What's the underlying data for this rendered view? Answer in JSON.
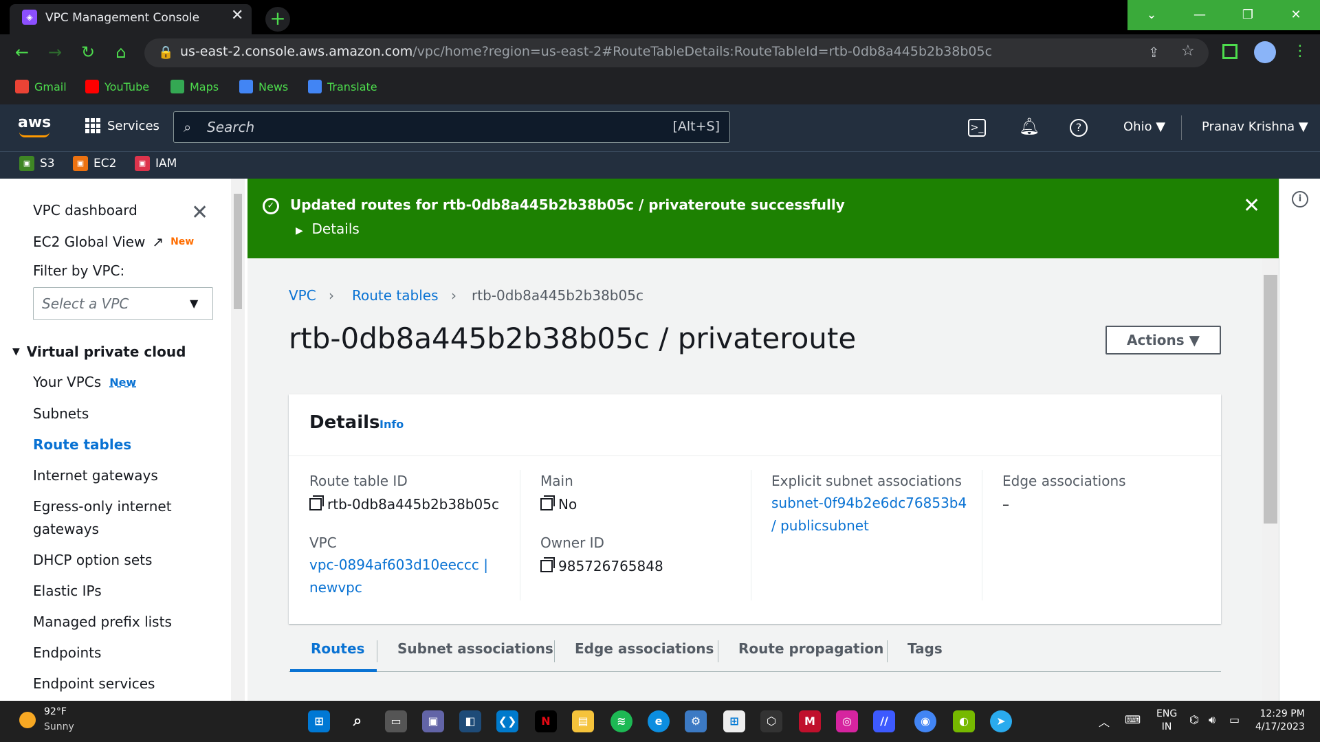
{
  "browser": {
    "tab_title": "VPC Management Console",
    "tab_close": "✕",
    "new_tab": "+",
    "url_host": "us-east-2.console.aws.amazon.com",
    "url_path": "/vpc/home?region=us-east-2#RouteTableDetails:RouteTableId=rtb-0db8a445b2b38b05c",
    "bookmarks": [
      {
        "label": "Gmail",
        "color": "#ea4335"
      },
      {
        "label": "YouTube",
        "color": "#ff0000"
      },
      {
        "label": "Maps",
        "color": "#34a853"
      },
      {
        "label": "News",
        "color": "#4285f4"
      },
      {
        "label": "Translate",
        "color": "#4285f4"
      }
    ]
  },
  "aws": {
    "logo": "aws",
    "services": "Services",
    "search_placeholder": "Search",
    "search_shortcut": "[Alt+S]",
    "region": "Ohio ▼",
    "user": "Pranav Krishna ▼",
    "favorites": [
      {
        "label": "S3",
        "color": "#3f8624",
        "icon": "S3"
      },
      {
        "label": "EC2",
        "color": "#ec7211",
        "icon": "EC2"
      },
      {
        "label": "IAM",
        "color": "#dd344c",
        "icon": "IAM"
      }
    ]
  },
  "sidebar": {
    "dashboard": "VPC dashboard",
    "global_view": "EC2 Global View",
    "global_view_badge": "New",
    "filter_label": "Filter by VPC:",
    "filter_placeholder": "Select a VPC",
    "section": "Virtual private cloud",
    "items": [
      {
        "label": "Your VPCs",
        "badge": "New"
      },
      {
        "label": "Subnets"
      },
      {
        "label": "Route tables"
      },
      {
        "label": "Internet gateways"
      },
      {
        "label": "Egress-only internet"
      },
      {
        "label": "gateways"
      },
      {
        "label": "DHCP option sets"
      },
      {
        "label": "Elastic IPs"
      },
      {
        "label": "Managed prefix lists"
      },
      {
        "label": "Endpoints"
      },
      {
        "label": "Endpoint services"
      }
    ]
  },
  "flash": {
    "message": "Updated routes for rtb-0db8a445b2b38b05c / privateroute successfully",
    "details": "Details"
  },
  "breadcrumb": [
    "VPC",
    "Route tables",
    "rtb-0db8a445b2b38b05c"
  ],
  "page": {
    "title": "rtb-0db8a445b2b38b05c / privateroute",
    "actions": "Actions ▼"
  },
  "details": {
    "title": "Details",
    "info": "Info",
    "route_table_id_label": "Route table ID",
    "route_table_id": "rtb-0db8a445b2b38b05c",
    "vpc_label": "VPC",
    "vpc_line1": "vpc-0894af603d10eeccc |",
    "vpc_line2": "newvpc",
    "main_label": "Main",
    "main": "No",
    "owner_label": "Owner ID",
    "owner": "985726765848",
    "explicit_label": "Explicit subnet associations",
    "explicit_line1": "subnet-0f94b2e6dc76853b4",
    "explicit_line2": "/ publicsubnet",
    "edge_label": "Edge associations",
    "edge": "–"
  },
  "tabs": [
    "Routes",
    "Subnet associations",
    "Edge associations",
    "Route propagation",
    "Tags"
  ],
  "taskbar": {
    "temp": "92°F",
    "condition": "Sunny",
    "lang1": "ENG",
    "lang2": "IN",
    "time": "12:29 PM",
    "date": "4/17/2023"
  }
}
